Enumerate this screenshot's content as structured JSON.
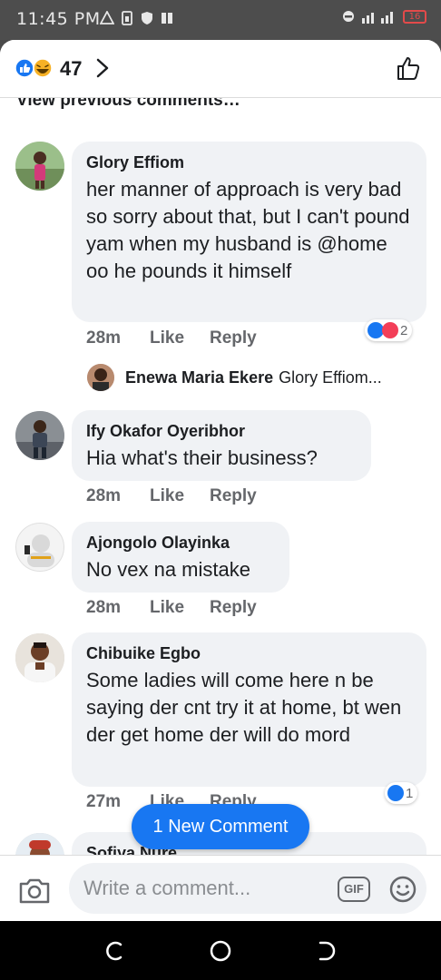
{
  "status_bar": {
    "time": "11:45 PM",
    "battery": "16",
    "icons": [
      "warning-icon",
      "sim-icon",
      "shield-icon",
      "book-icon",
      "alarm-icon",
      "signal-icon",
      "battery-icon"
    ]
  },
  "header": {
    "reaction_count": "47",
    "reaction_types": [
      "like",
      "haha"
    ]
  },
  "comments_area": {
    "view_previous": "View previous comments…"
  },
  "comments": [
    {
      "author": "Glory Effiom",
      "text": "her manner of approach is very bad so sorry about that, but I can't pound yam when my husband is @home oo he pounds it himself",
      "time": "28m",
      "like": "Like",
      "reply": "Reply",
      "reaction_count": "2",
      "reaction_types": [
        "like",
        "love"
      ]
    },
    {
      "author": "Ify Okafor Oyeribhor",
      "text": "Hia what's  their business?",
      "time": "28m",
      "like": "Like",
      "reply": "Reply"
    },
    {
      "author": "Ajongolo Olayinka",
      "text": "No vex na mistake",
      "time": "28m",
      "like": "Like",
      "reply": "Reply"
    },
    {
      "author": "Chibuike Egbo",
      "text": "Some ladies will come here n be saying der cnt try it at home, bt wen der get  home der will do mord",
      "time": "27m",
      "like": "Like",
      "reply": "Reply",
      "reaction_count": "1",
      "reaction_types": [
        "like"
      ]
    },
    {
      "author": "Sofiya Nure"
    }
  ],
  "reply_preview": {
    "author": "Enewa Maria Ekere",
    "snippet": "Glory Effiom..."
  },
  "new_comment_pill": "1 New Comment",
  "composer": {
    "placeholder": "Write a comment...",
    "gif_label": "GIF"
  },
  "colors": {
    "accent": "#1877f2",
    "love": "#f33e58",
    "bubble": "#f0f2f5"
  }
}
